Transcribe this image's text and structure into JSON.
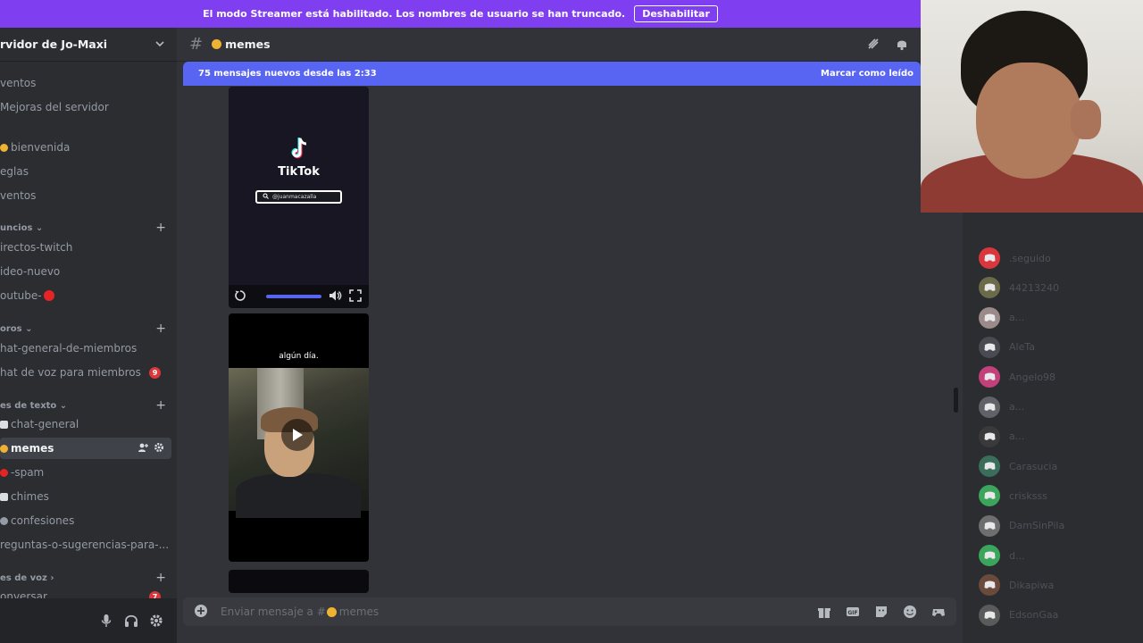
{
  "banner": {
    "message": "El modo Streamer está habilitado. Los nombres de usuario se han truncado.",
    "button_label": "Deshabilitar"
  },
  "server": {
    "name": "rvidor de Jo-Maxi"
  },
  "sidebar": {
    "top_items": [
      {
        "label": "ventos"
      },
      {
        "label": "Mejoras del servidor"
      }
    ],
    "info_items": [
      {
        "label": "bienvenida"
      },
      {
        "label": "eglas"
      },
      {
        "label": "ventos"
      }
    ],
    "categories": [
      {
        "label": "uncios",
        "items": [
          {
            "label": "irectos-twitch"
          },
          {
            "label": "ideo-nuevo"
          },
          {
            "label": "outube-"
          }
        ]
      },
      {
        "label": "oros",
        "items": [
          {
            "label": "hat-general-de-miembros"
          },
          {
            "label": "hat de voz para miembros",
            "badge": "9"
          }
        ]
      },
      {
        "label": "es de texto",
        "items": [
          {
            "label": "chat-general"
          },
          {
            "label": "memes",
            "active": true
          },
          {
            "label": "-spam"
          },
          {
            "label": "chimes"
          },
          {
            "label": "confesiones"
          },
          {
            "label": "reguntas-o-sugerencias-para-..."
          }
        ]
      },
      {
        "label": "es de voz",
        "items": [
          {
            "label": "onversar",
            "badge": "7"
          }
        ]
      }
    ]
  },
  "channel": {
    "name": "memes",
    "new_messages_text": "75 mensajes nuevos desde las 2:33",
    "mark_read_label": "Marcar como leído",
    "composer_placeholder": "Enviar mensaje a #",
    "composer_channel": "memes"
  },
  "videos": {
    "tiktok_brand": "TikTok",
    "tiktok_handle": "@juanmacazalla",
    "caption": "algún día."
  },
  "members": [
    {
      "name": ".seguido",
      "color": "#da373c"
    },
    {
      "name": "44213240",
      "color": "#6b6b4a"
    },
    {
      "name": "a...",
      "color": "#9a8a8a"
    },
    {
      "name": "AleTa",
      "color": "#4a4a52"
    },
    {
      "name": "Angelo98",
      "color": "#c3417a"
    },
    {
      "name": "a...",
      "color": "#5f6368"
    },
    {
      "name": "a...",
      "color": "#3a3a3a"
    },
    {
      "name": "Carasucia",
      "color": "#3b6e5a"
    },
    {
      "name": "crisksss",
      "color": "#3ba55c"
    },
    {
      "name": "DamSinPila",
      "color": "#6e6e6e"
    },
    {
      "name": "d...",
      "color": "#3ba55c"
    },
    {
      "name": "Dikapiwa",
      "color": "#6a4a3a"
    },
    {
      "name": "EdsonGaa",
      "color": "#5a5a5a"
    }
  ],
  "colors": {
    "banner": "#7f3ff0",
    "accent": "#5865f2",
    "badge": "#da373c"
  }
}
